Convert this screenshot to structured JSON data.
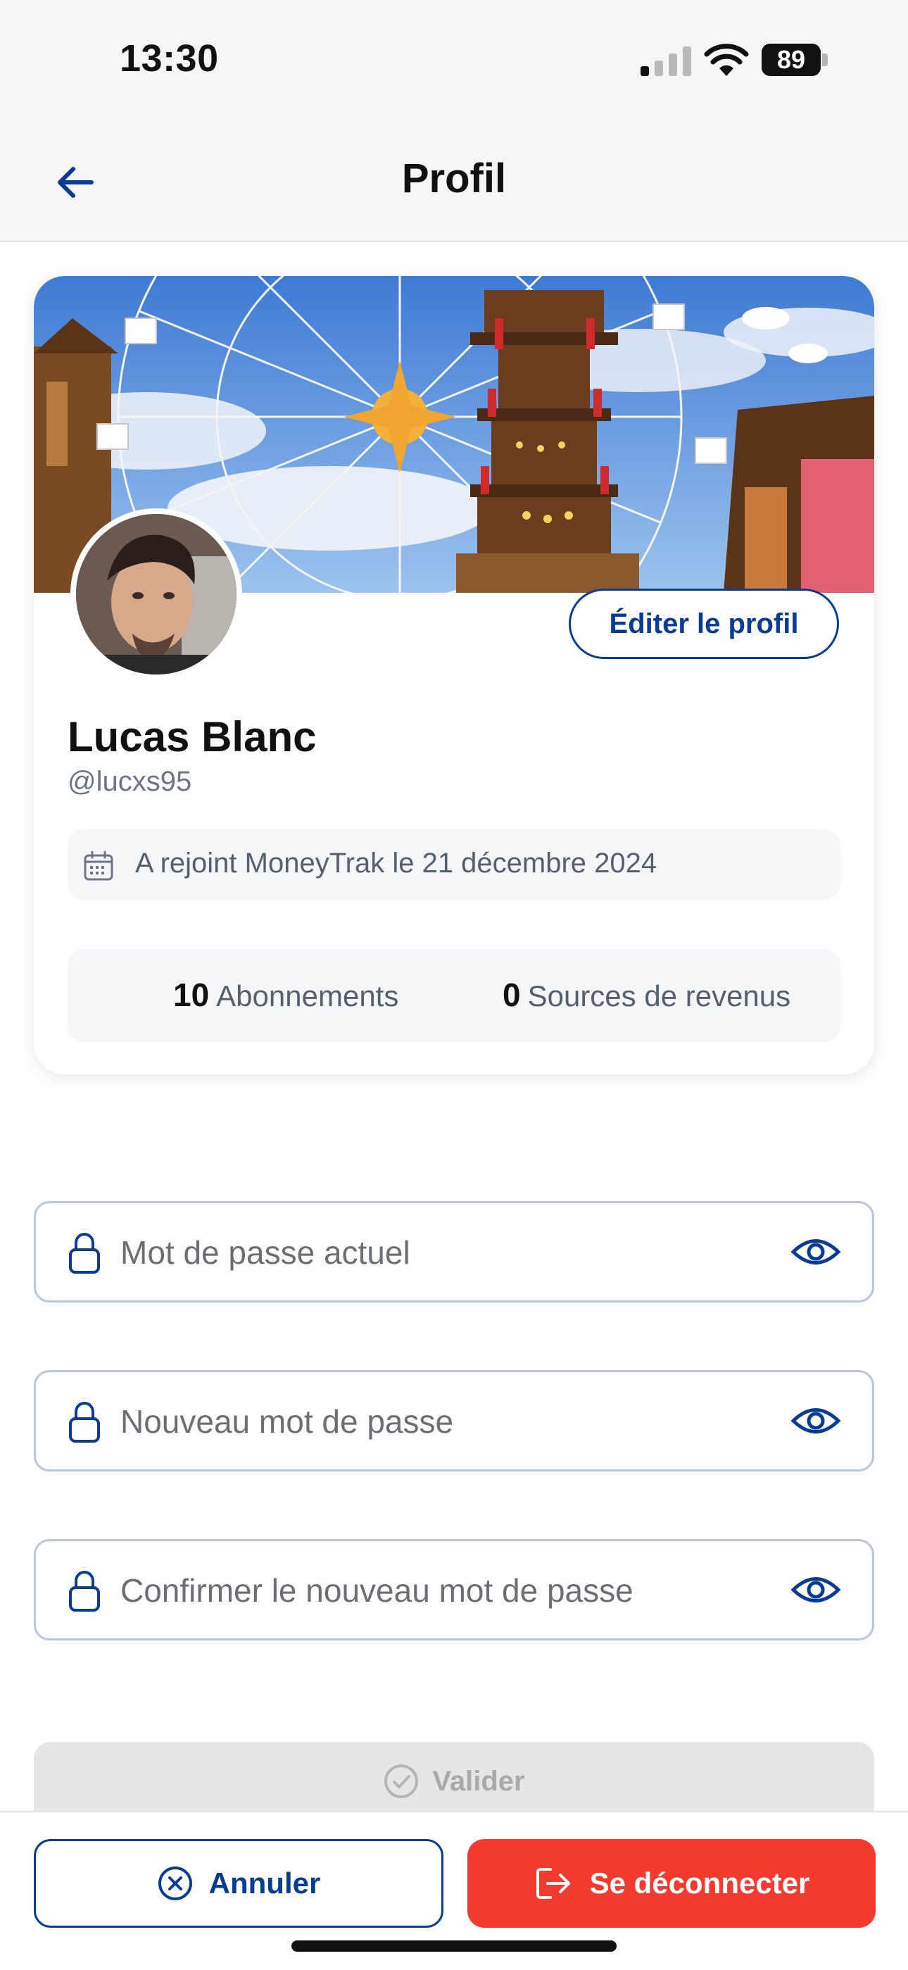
{
  "status_bar": {
    "time": "13:30",
    "battery": "89"
  },
  "nav": {
    "title": "Profil"
  },
  "profile": {
    "edit_label": "Éditer le profil",
    "name": "Lucas Blanc",
    "handle": "@lucxs95",
    "joined": "A rejoint MoneyTrak le 21 décembre 2024",
    "stats": {
      "subscriptions_count": "10",
      "subscriptions_label": "Abonnements",
      "income_count": "0",
      "income_label": "Sources de revenus"
    }
  },
  "password_form": {
    "current_placeholder": "Mot de passe actuel",
    "new_placeholder": "Nouveau mot de passe",
    "confirm_placeholder": "Confirmer le nouveau mot de passe",
    "submit_label": "Valider"
  },
  "actions": {
    "cancel_label": "Annuler",
    "logout_label": "Se déconnecter"
  },
  "colors": {
    "primary": "#0a3d91",
    "danger": "#f23a2e",
    "field_border": "#b7c6da"
  }
}
